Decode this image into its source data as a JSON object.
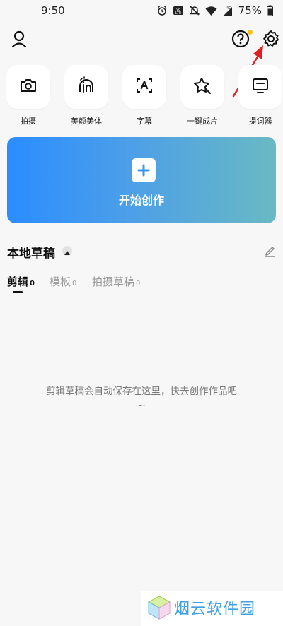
{
  "status_bar": {
    "time": "9:50",
    "network": "4G",
    "volte": "VoLTE",
    "battery": "75%"
  },
  "top_bar": {
    "profile_icon": "person-icon",
    "help_icon": "question-circle-icon",
    "settings_icon": "gear-icon",
    "notify_color": "#f4c21b"
  },
  "tools": [
    {
      "label": "拍摄",
      "icon": "camera-icon"
    },
    {
      "label": "美颜美体",
      "icon": "beauty-icon"
    },
    {
      "label": "字幕",
      "icon": "subtitle-icon"
    },
    {
      "label": "一键成片",
      "icon": "magic-icon"
    },
    {
      "label": "提词器",
      "icon": "teleprompter-icon"
    }
  ],
  "create": {
    "label": "开始创作",
    "gradient_start": "#2a8dff",
    "gradient_end": "#6ab9c4"
  },
  "drafts": {
    "title": "本地草稿",
    "tabs": [
      {
        "label": "剪辑",
        "count": "0"
      },
      {
        "label": "模板",
        "count": "0"
      },
      {
        "label": "拍摄草稿",
        "count": "0"
      }
    ],
    "empty_line1": "剪辑草稿会自动保存在这里，快去创作作品吧",
    "empty_line2": "~"
  },
  "watermark": {
    "text": "烟云软件园"
  }
}
